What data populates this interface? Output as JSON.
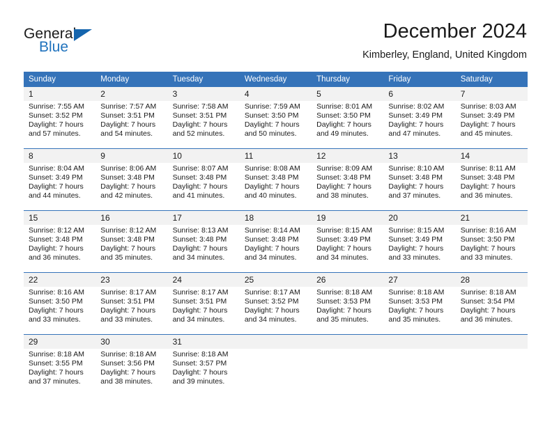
{
  "brand": {
    "name_part1": "General",
    "name_part2": "Blue",
    "triangle_icon": "triangle-icon",
    "color_primary": "#1f72bd",
    "color_dark": "#1565ae"
  },
  "header": {
    "title": "December 2024",
    "subtitle": "Kimberley, England, United Kingdom"
  },
  "theme": {
    "header_blue": "#3573b9",
    "daynum_gray": "#f2f2f2",
    "text": "#1a1a1a"
  },
  "weekday_headers": [
    "Sunday",
    "Monday",
    "Tuesday",
    "Wednesday",
    "Thursday",
    "Friday",
    "Saturday"
  ],
  "weeks": [
    {
      "days": [
        {
          "num": "1",
          "sunrise": "Sunrise: 7:55 AM",
          "sunset": "Sunset: 3:52 PM",
          "daylight1": "Daylight: 7 hours",
          "daylight2": "and 57 minutes."
        },
        {
          "num": "2",
          "sunrise": "Sunrise: 7:57 AM",
          "sunset": "Sunset: 3:51 PM",
          "daylight1": "Daylight: 7 hours",
          "daylight2": "and 54 minutes."
        },
        {
          "num": "3",
          "sunrise": "Sunrise: 7:58 AM",
          "sunset": "Sunset: 3:51 PM",
          "daylight1": "Daylight: 7 hours",
          "daylight2": "and 52 minutes."
        },
        {
          "num": "4",
          "sunrise": "Sunrise: 7:59 AM",
          "sunset": "Sunset: 3:50 PM",
          "daylight1": "Daylight: 7 hours",
          "daylight2": "and 50 minutes."
        },
        {
          "num": "5",
          "sunrise": "Sunrise: 8:01 AM",
          "sunset": "Sunset: 3:50 PM",
          "daylight1": "Daylight: 7 hours",
          "daylight2": "and 49 minutes."
        },
        {
          "num": "6",
          "sunrise": "Sunrise: 8:02 AM",
          "sunset": "Sunset: 3:49 PM",
          "daylight1": "Daylight: 7 hours",
          "daylight2": "and 47 minutes."
        },
        {
          "num": "7",
          "sunrise": "Sunrise: 8:03 AM",
          "sunset": "Sunset: 3:49 PM",
          "daylight1": "Daylight: 7 hours",
          "daylight2": "and 45 minutes."
        }
      ]
    },
    {
      "days": [
        {
          "num": "8",
          "sunrise": "Sunrise: 8:04 AM",
          "sunset": "Sunset: 3:49 PM",
          "daylight1": "Daylight: 7 hours",
          "daylight2": "and 44 minutes."
        },
        {
          "num": "9",
          "sunrise": "Sunrise: 8:06 AM",
          "sunset": "Sunset: 3:48 PM",
          "daylight1": "Daylight: 7 hours",
          "daylight2": "and 42 minutes."
        },
        {
          "num": "10",
          "sunrise": "Sunrise: 8:07 AM",
          "sunset": "Sunset: 3:48 PM",
          "daylight1": "Daylight: 7 hours",
          "daylight2": "and 41 minutes."
        },
        {
          "num": "11",
          "sunrise": "Sunrise: 8:08 AM",
          "sunset": "Sunset: 3:48 PM",
          "daylight1": "Daylight: 7 hours",
          "daylight2": "and 40 minutes."
        },
        {
          "num": "12",
          "sunrise": "Sunrise: 8:09 AM",
          "sunset": "Sunset: 3:48 PM",
          "daylight1": "Daylight: 7 hours",
          "daylight2": "and 38 minutes."
        },
        {
          "num": "13",
          "sunrise": "Sunrise: 8:10 AM",
          "sunset": "Sunset: 3:48 PM",
          "daylight1": "Daylight: 7 hours",
          "daylight2": "and 37 minutes."
        },
        {
          "num": "14",
          "sunrise": "Sunrise: 8:11 AM",
          "sunset": "Sunset: 3:48 PM",
          "daylight1": "Daylight: 7 hours",
          "daylight2": "and 36 minutes."
        }
      ]
    },
    {
      "days": [
        {
          "num": "15",
          "sunrise": "Sunrise: 8:12 AM",
          "sunset": "Sunset: 3:48 PM",
          "daylight1": "Daylight: 7 hours",
          "daylight2": "and 36 minutes."
        },
        {
          "num": "16",
          "sunrise": "Sunrise: 8:12 AM",
          "sunset": "Sunset: 3:48 PM",
          "daylight1": "Daylight: 7 hours",
          "daylight2": "and 35 minutes."
        },
        {
          "num": "17",
          "sunrise": "Sunrise: 8:13 AM",
          "sunset": "Sunset: 3:48 PM",
          "daylight1": "Daylight: 7 hours",
          "daylight2": "and 34 minutes."
        },
        {
          "num": "18",
          "sunrise": "Sunrise: 8:14 AM",
          "sunset": "Sunset: 3:48 PM",
          "daylight1": "Daylight: 7 hours",
          "daylight2": "and 34 minutes."
        },
        {
          "num": "19",
          "sunrise": "Sunrise: 8:15 AM",
          "sunset": "Sunset: 3:49 PM",
          "daylight1": "Daylight: 7 hours",
          "daylight2": "and 34 minutes."
        },
        {
          "num": "20",
          "sunrise": "Sunrise: 8:15 AM",
          "sunset": "Sunset: 3:49 PM",
          "daylight1": "Daylight: 7 hours",
          "daylight2": "and 33 minutes."
        },
        {
          "num": "21",
          "sunrise": "Sunrise: 8:16 AM",
          "sunset": "Sunset: 3:50 PM",
          "daylight1": "Daylight: 7 hours",
          "daylight2": "and 33 minutes."
        }
      ]
    },
    {
      "days": [
        {
          "num": "22",
          "sunrise": "Sunrise: 8:16 AM",
          "sunset": "Sunset: 3:50 PM",
          "daylight1": "Daylight: 7 hours",
          "daylight2": "and 33 minutes."
        },
        {
          "num": "23",
          "sunrise": "Sunrise: 8:17 AM",
          "sunset": "Sunset: 3:51 PM",
          "daylight1": "Daylight: 7 hours",
          "daylight2": "and 33 minutes."
        },
        {
          "num": "24",
          "sunrise": "Sunrise: 8:17 AM",
          "sunset": "Sunset: 3:51 PM",
          "daylight1": "Daylight: 7 hours",
          "daylight2": "and 34 minutes."
        },
        {
          "num": "25",
          "sunrise": "Sunrise: 8:17 AM",
          "sunset": "Sunset: 3:52 PM",
          "daylight1": "Daylight: 7 hours",
          "daylight2": "and 34 minutes."
        },
        {
          "num": "26",
          "sunrise": "Sunrise: 8:18 AM",
          "sunset": "Sunset: 3:53 PM",
          "daylight1": "Daylight: 7 hours",
          "daylight2": "and 35 minutes."
        },
        {
          "num": "27",
          "sunrise": "Sunrise: 8:18 AM",
          "sunset": "Sunset: 3:53 PM",
          "daylight1": "Daylight: 7 hours",
          "daylight2": "and 35 minutes."
        },
        {
          "num": "28",
          "sunrise": "Sunrise: 8:18 AM",
          "sunset": "Sunset: 3:54 PM",
          "daylight1": "Daylight: 7 hours",
          "daylight2": "and 36 minutes."
        }
      ]
    },
    {
      "days": [
        {
          "num": "29",
          "sunrise": "Sunrise: 8:18 AM",
          "sunset": "Sunset: 3:55 PM",
          "daylight1": "Daylight: 7 hours",
          "daylight2": "and 37 minutes."
        },
        {
          "num": "30",
          "sunrise": "Sunrise: 8:18 AM",
          "sunset": "Sunset: 3:56 PM",
          "daylight1": "Daylight: 7 hours",
          "daylight2": "and 38 minutes."
        },
        {
          "num": "31",
          "sunrise": "Sunrise: 8:18 AM",
          "sunset": "Sunset: 3:57 PM",
          "daylight1": "Daylight: 7 hours",
          "daylight2": "and 39 minutes."
        },
        {
          "num": "",
          "sunrise": "",
          "sunset": "",
          "daylight1": "",
          "daylight2": ""
        },
        {
          "num": "",
          "sunrise": "",
          "sunset": "",
          "daylight1": "",
          "daylight2": ""
        },
        {
          "num": "",
          "sunrise": "",
          "sunset": "",
          "daylight1": "",
          "daylight2": ""
        },
        {
          "num": "",
          "sunrise": "",
          "sunset": "",
          "daylight1": "",
          "daylight2": ""
        }
      ]
    }
  ]
}
